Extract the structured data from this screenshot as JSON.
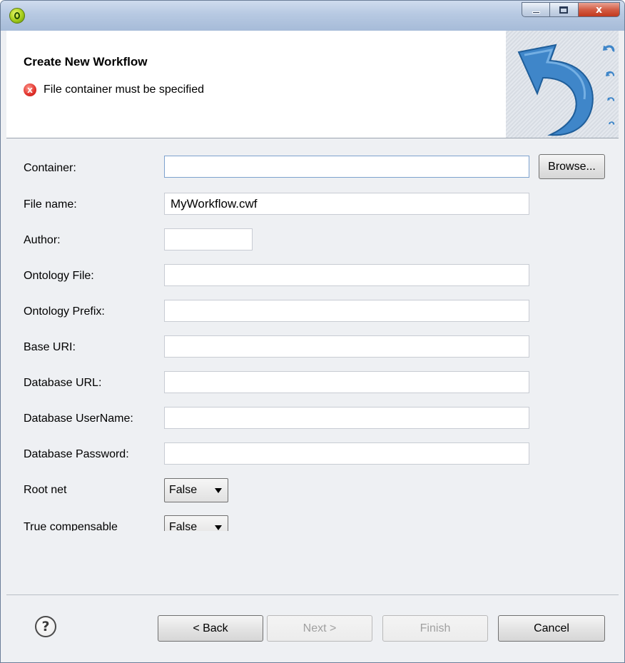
{
  "window": {
    "app_icon": "eclipse-like-app-icon",
    "controls": {
      "minimize": "minimize-icon",
      "maximize": "maximize-icon",
      "close": "x"
    }
  },
  "header": {
    "title": "Create New Workflow",
    "error_icon": "x",
    "error_message": "File container must be specified",
    "banner_icon": "undo-arrow-icon"
  },
  "form": {
    "container": {
      "label": "Container:",
      "value": "",
      "browse_label": "Browse..."
    },
    "file_name": {
      "label": "File name:",
      "value": "MyWorkflow.cwf"
    },
    "author": {
      "label": "Author:",
      "value": ""
    },
    "ontology_file": {
      "label": "Ontology File:",
      "value": ""
    },
    "ontology_prefix": {
      "label": "Ontology Prefix:",
      "value": ""
    },
    "base_uri": {
      "label": "Base URI:",
      "value": ""
    },
    "database_url": {
      "label": "Database URL:",
      "value": ""
    },
    "database_username": {
      "label": "Database UserName:",
      "value": ""
    },
    "database_password": {
      "label": "Database Password:",
      "value": ""
    },
    "root_net": {
      "label": "Root net",
      "selected": "False"
    },
    "true_compensable": {
      "label": "True compensable",
      "selected": "False"
    }
  },
  "footer": {
    "help_icon": "?",
    "back_label": "< Back",
    "next_label": "Next >",
    "finish_label": "Finish",
    "cancel_label": "Cancel"
  },
  "colors": {
    "error_red": "#e0302a",
    "banner_arrow": "#3f86c9",
    "focus_border": "#7da2ce"
  }
}
